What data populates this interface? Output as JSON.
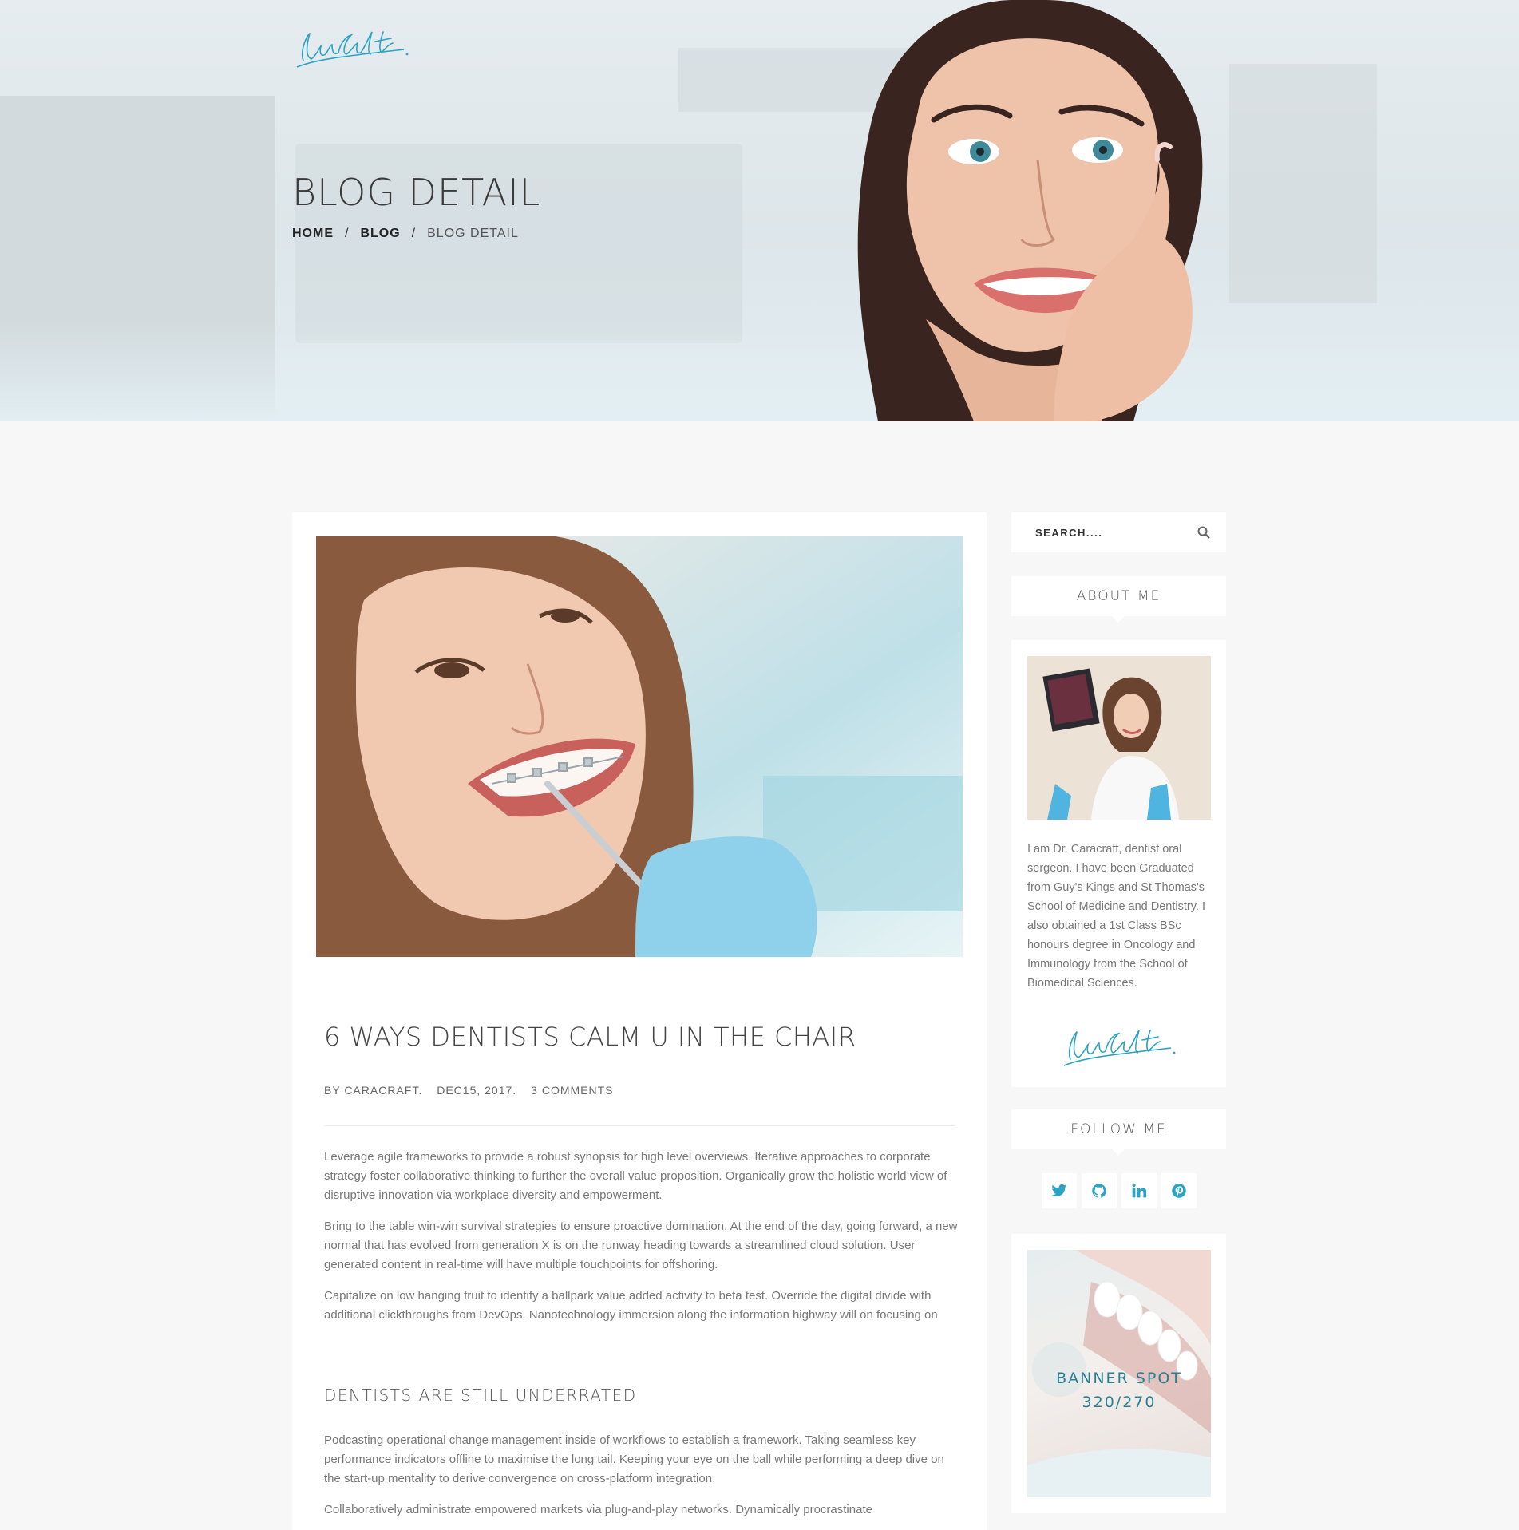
{
  "hero": {
    "title": "BLOG DETAIL",
    "breadcrumb": {
      "home": "HOME",
      "blog": "BLOG",
      "current": "BLOG DETAIL",
      "separator": "/"
    }
  },
  "post": {
    "title": "6 WAYS DENTISTS CALM U IN THE CHAIR",
    "meta": {
      "author": "BY CARACRAFT.",
      "date": "DEC15, 2017.",
      "comments": "3 COMMENTS"
    },
    "paragraphs": [
      "Leverage agile frameworks to provide a robust synopsis for high level overviews. Iterative approaches to corporate strategy foster collaborative thinking to further the overall value proposition. Organically grow the holistic world view of disruptive innovation via workplace diversity and empowerment.",
      "Bring to the table win-win survival strategies to ensure proactive domination. At the end of the day, going forward, a new normal that has evolved from generation X is on the runway heading towards a streamlined cloud solution. User generated content in real-time will have multiple touchpoints for offshoring.",
      "Capitalize on low hanging fruit to identify a ballpark value added activity to beta test. Override the digital divide with additional clickthroughs from DevOps. Nanotechnology immersion along the information highway will on focusing on"
    ],
    "subheading": "DENTISTS ARE STILL UNDERRATED",
    "paragraphs2": [
      "Podcasting operational change management inside of workflows to establish a framework. Taking seamless key performance indicators offline to maximise the long tail. Keeping your eye on the ball while performing a deep dive on the start-up mentality to derive convergence on cross-platform integration.",
      "Collaboratively administrate empowered markets via plug-and-play networks. Dynamically procrastinate"
    ]
  },
  "sidebar": {
    "search": {
      "placeholder": "SEARCH...."
    },
    "about": {
      "heading": "ABOUT ME",
      "text": "I am Dr. Caracraft, dentist oral sergeon. I have been Graduated from Guy's Kings and St Thomas's School of Medicine and Dentistry. I also obtained a 1st Class BSc honours degree in Oncology and Immunology from the School of Biomedical Sciences."
    },
    "follow": {
      "heading": "FOLLOW ME",
      "icons": [
        "twitter-icon",
        "github-icon",
        "linkedin-icon",
        "pinterest-icon"
      ]
    },
    "banner": {
      "line1": "BANNER SPOT",
      "line2": "320/270"
    }
  },
  "colors": {
    "accent": "#2ba3c3",
    "banner_text": "#2a7f93",
    "background": "#f7f7f7",
    "card": "#ffffff"
  }
}
